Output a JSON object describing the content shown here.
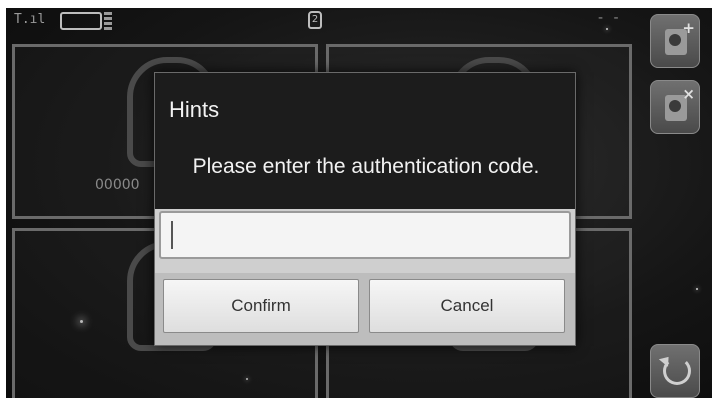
{
  "status_bar": {
    "signal_text": "T.ıl",
    "lock_badge": "2",
    "dashes": "- -"
  },
  "panels": [
    {
      "id_label": "00000"
    },
    {
      "id_label": ""
    },
    {
      "id_label": ""
    },
    {
      "id_label": ""
    }
  ],
  "sidebar": {
    "add_badge": "+",
    "remove_badge": "×"
  },
  "dialog": {
    "title": "Hints",
    "message": "Please enter the authentication code.",
    "input_value": "",
    "confirm_label": "Confirm",
    "cancel_label": "Cancel"
  }
}
